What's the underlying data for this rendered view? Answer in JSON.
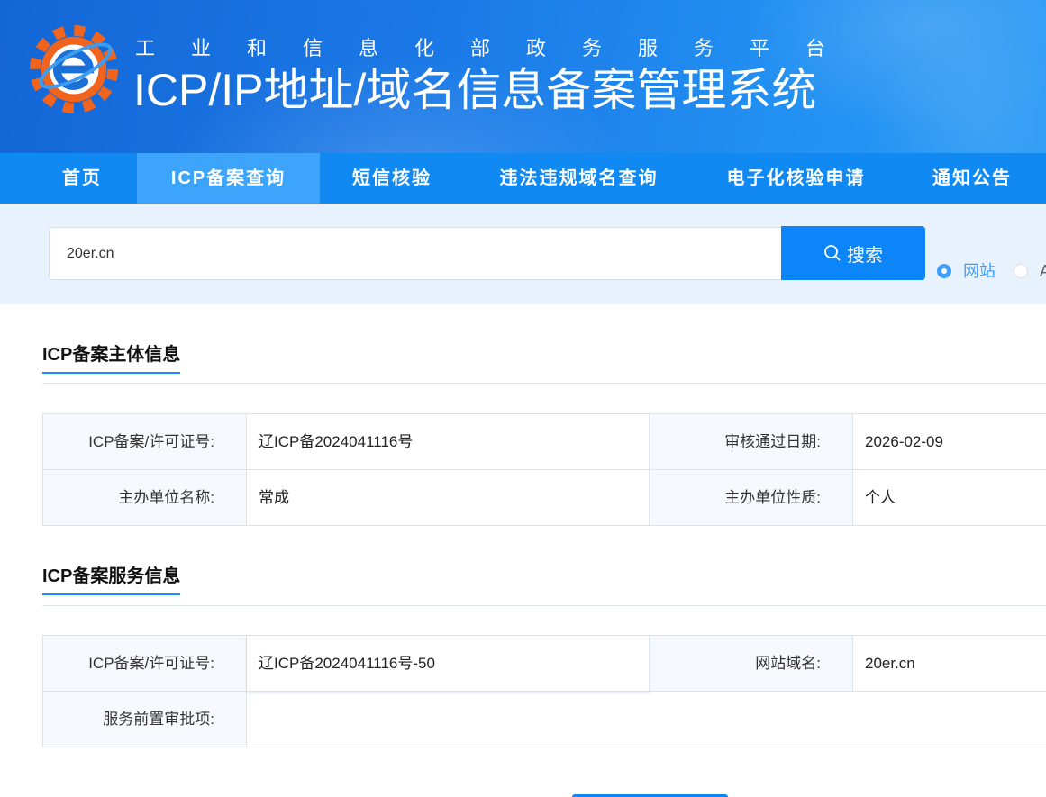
{
  "theme": {
    "header_start": "#1466d6",
    "header_end": "#2a9af5",
    "nav_bg": "#1089f3",
    "nav_active_bg": "#3da4fb",
    "search_area_bg": "#e8f2fd",
    "primary": "#0b85f7",
    "radio_selected": "#409eff",
    "logo_orange": "#f0641e",
    "logo_blue": "#1a6fd8",
    "accent_underline": "#1a8cff"
  },
  "header": {
    "logo_icon": "gear-e-logo-icon",
    "subtitle": "工业和信息化部政务服务平台",
    "title": "ICP/IP地址/域名信息备案管理系统"
  },
  "nav": {
    "items": [
      {
        "label": "首页",
        "active": false
      },
      {
        "label": "ICP备案查询",
        "active": true
      },
      {
        "label": "短信核验",
        "active": false
      },
      {
        "label": "违法违规域名查询",
        "active": false
      },
      {
        "label": "电子化核验申请",
        "active": false
      },
      {
        "label": "通知公告",
        "active": false
      }
    ]
  },
  "search": {
    "value": "20er.cn",
    "button_label": "搜索",
    "button_icon": "search-icon",
    "options": [
      {
        "label": "网站",
        "selected": true
      },
      {
        "label": "A",
        "selected": false
      }
    ]
  },
  "sections": [
    {
      "title": "ICP备案主体信息",
      "fields": [
        {
          "label": "ICP备案/许可证号:",
          "value": "辽ICP备2024041116号"
        },
        {
          "label": "审核通过日期:",
          "value": "2026-02-09"
        },
        {
          "label": "主办单位名称:",
          "value": "常成"
        },
        {
          "label": "主办单位性质:",
          "value": "个人"
        }
      ]
    },
    {
      "title": "ICP备案服务信息",
      "fields": [
        {
          "label": "ICP备案/许可证号:",
          "value": "辽ICP备2024041116号-50"
        },
        {
          "label": "网站域名:",
          "value": "20er.cn"
        },
        {
          "label": "服务前置审批项:",
          "value": ""
        }
      ]
    }
  ]
}
